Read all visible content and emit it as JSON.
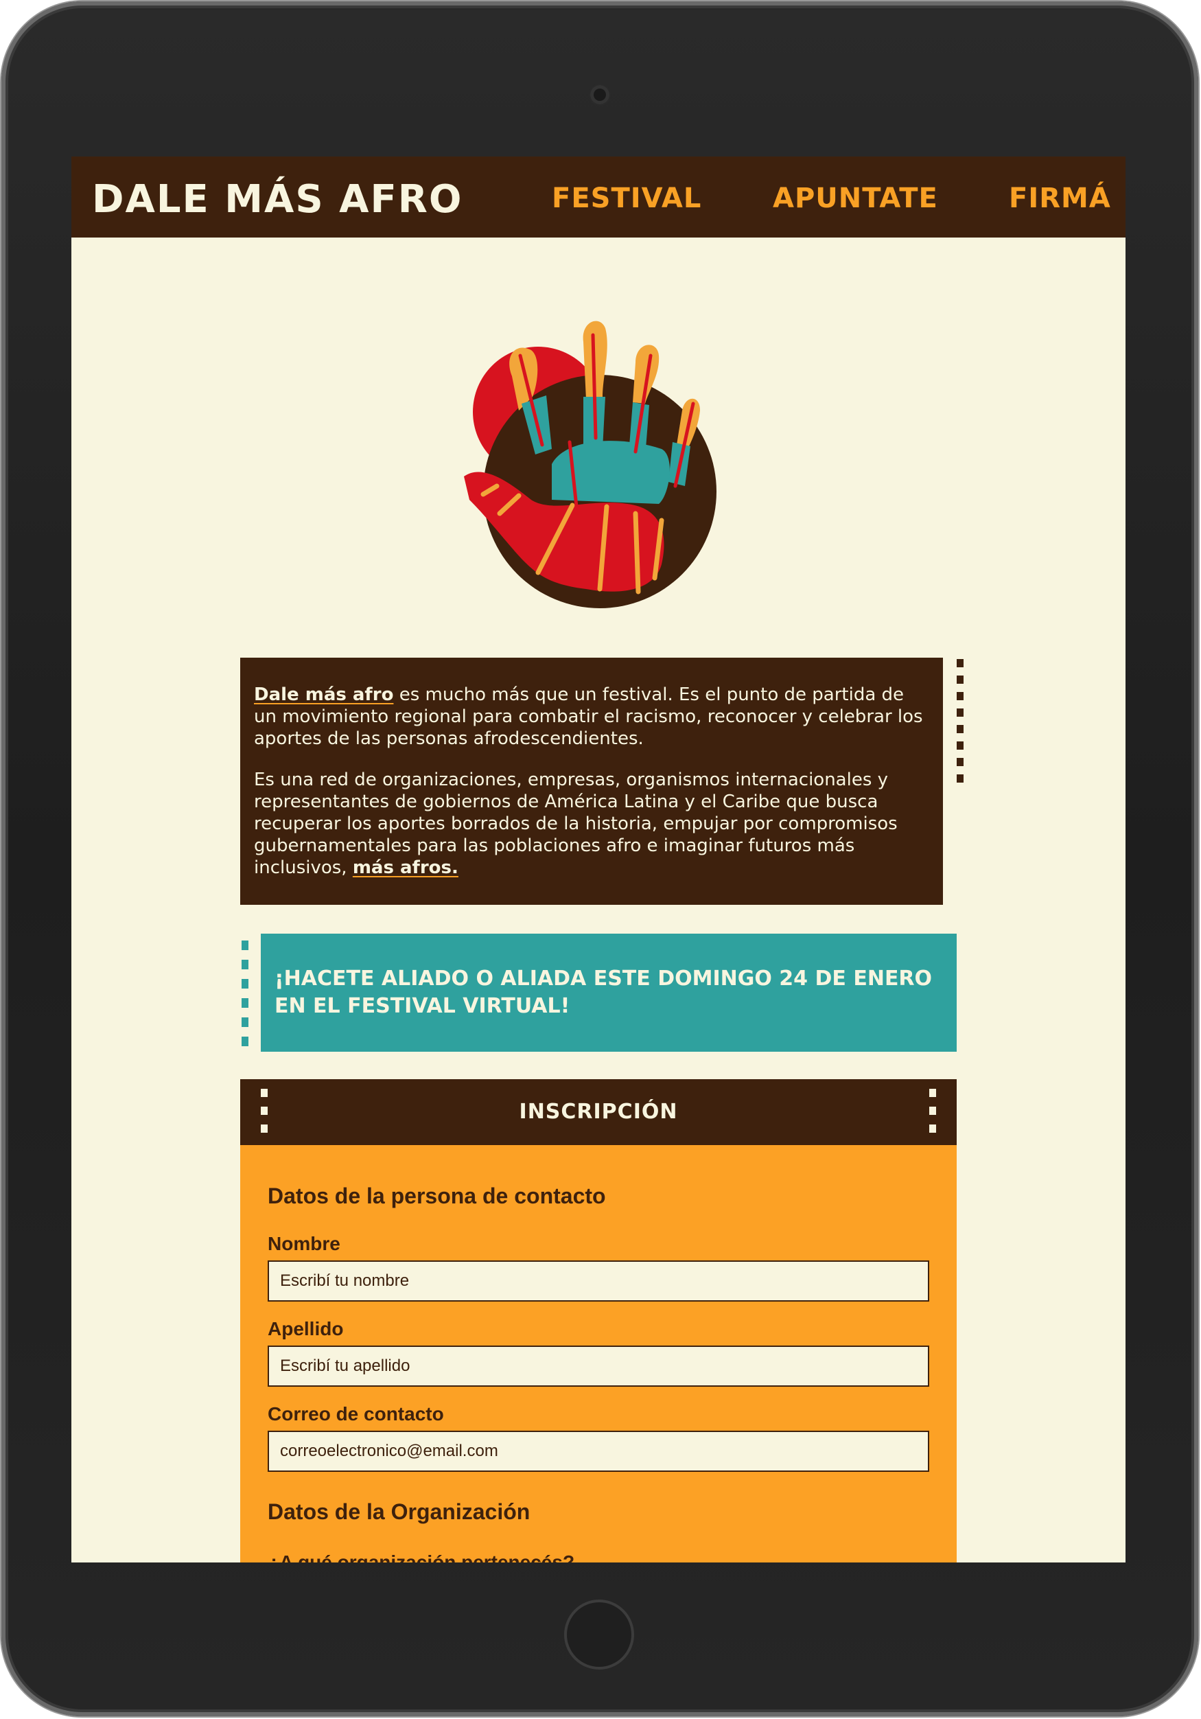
{
  "header": {
    "brand": "DALE MÁS AFRO",
    "nav": [
      "FESTIVAL",
      "APUNTATE",
      "FIRMÁ"
    ]
  },
  "about": {
    "p1_highlight": "Dale más afro",
    "p1_rest": " es mucho más que un festival. Es el punto de partida de un movimiento regional para combatir el racismo, reconocer y celebrar los aportes de las personas afrodescendientes.",
    "p2_text": "Es una red de organizaciones, empresas, organismos internacionales y representantes de gobiernos de América Latina y el Caribe que busca recuperar los aportes borrados de la historia, empujar por compromisos gubernamentales para las poblaciones afro e imaginar futuros más inclusivos, ",
    "p2_highlight": "más afros."
  },
  "cta": {
    "text": "¡HACETE ALIADO O ALIADA ESTE DOMINGO 24 DE ENERO EN EL FESTIVAL VIRTUAL!"
  },
  "form": {
    "title": "INSCRIPCIÓN",
    "contact_section": "Datos de la persona de contacto",
    "fields": [
      {
        "label": "Nombre",
        "placeholder": "Escribí tu nombre"
      },
      {
        "label": "Apellido",
        "placeholder": "Escribí tu apellido"
      },
      {
        "label": "Correo de contacto",
        "placeholder": "correoelectronico@email.com"
      }
    ],
    "org_section": "Datos de la Organización",
    "org_question": "¿A qué organización pertenecés?"
  },
  "colors": {
    "brown": "#3e210d",
    "cream": "#f8f5df",
    "orange": "#fca125",
    "teal": "#2fa19e",
    "red": "#d7131f"
  }
}
